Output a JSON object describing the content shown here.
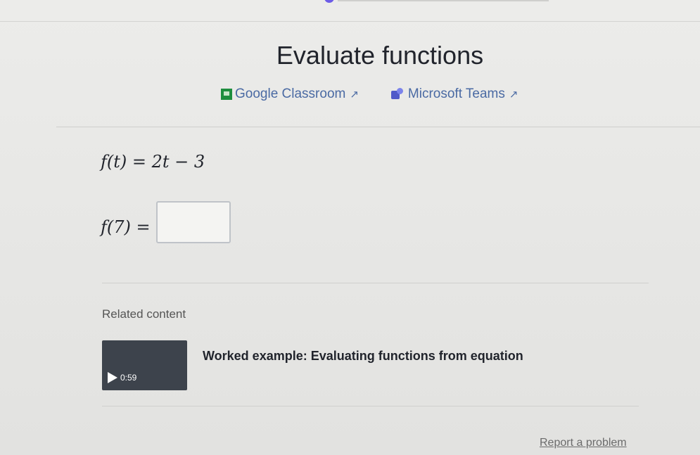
{
  "exercise": {
    "title": "Evaluate functions"
  },
  "share": {
    "google_classroom": "Google Classroom",
    "microsoft_teams": "Microsoft Teams"
  },
  "problem": {
    "definition": "f(t) = 2t − 3",
    "question": "f(7) =",
    "answer_value": ""
  },
  "related": {
    "label": "Related content",
    "video": {
      "title": "Worked example: Evaluating functions from equation",
      "duration": "0:59"
    }
  },
  "footer": {
    "report_label": "Report a problem"
  },
  "colors": {
    "link": "#4a6aa3",
    "google_classroom": "#1e8e3e",
    "teams": "#5059c9",
    "progress": "#6c5ce7"
  }
}
